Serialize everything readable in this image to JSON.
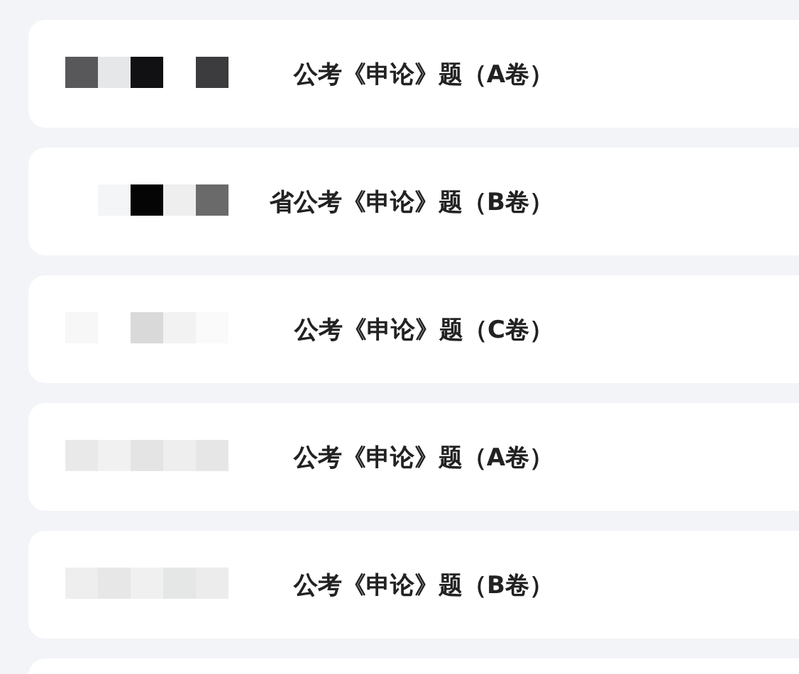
{
  "items": [
    {
      "title": "公考《申论》题（A卷）"
    },
    {
      "title": "省公考《申论》题（B卷）"
    },
    {
      "title": "公考《申论》题（C卷）"
    },
    {
      "title": "公考《申论》题（A卷）"
    },
    {
      "title": "公考《申论》题（B卷）"
    }
  ]
}
